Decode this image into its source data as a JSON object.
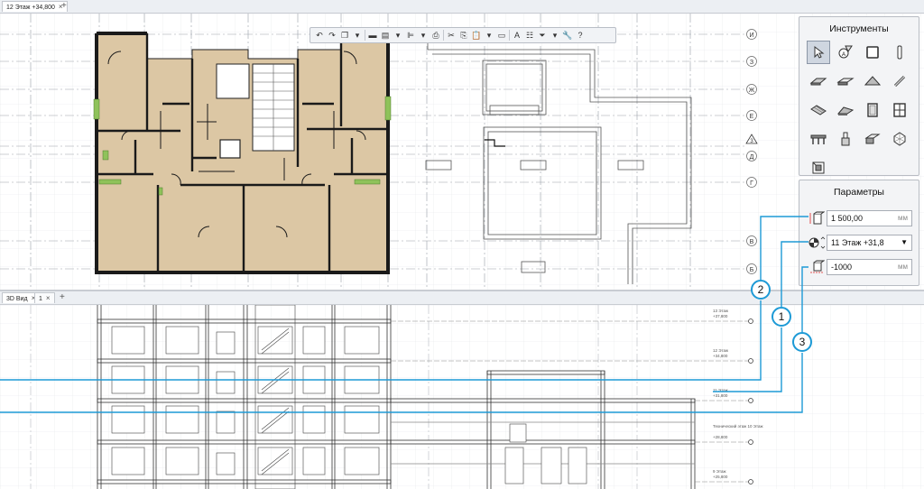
{
  "top_tabs": {
    "tab1": "12 Этаж +34,800",
    "close": "×",
    "add": "+"
  },
  "bottom_tabs": {
    "tab1": "3D Вид",
    "tab2": "1",
    "close": "×",
    "add": "+"
  },
  "tools_panel": {
    "title": "Инструменты"
  },
  "params_panel": {
    "title": "Параметры",
    "height_value": "1 500,00",
    "height_unit": "мм",
    "level_value": "11 Этаж +31,8",
    "offset_value": "-1000",
    "offset_unit": "мм"
  },
  "callouts": {
    "c1": "1",
    "c2": "2",
    "c3": "3"
  },
  "axes_right": [
    "И",
    "З",
    "Ж",
    "Е",
    "Д",
    "Г",
    "В",
    "Б"
  ],
  "axis_marker": "3",
  "level_labels": [
    {
      "name": "13 Этаж",
      "value": "+37,800"
    },
    {
      "name": "12 Этаж",
      "value": "+34,800"
    },
    {
      "name": "11 Этаж",
      "value": "+31,800"
    },
    {
      "name": "Технический этаж 10 Этаж",
      "value": "+28,800"
    },
    {
      "name": "9 Этаж",
      "value": "+25,800"
    }
  ],
  "accent_color": "#1d9ad6"
}
